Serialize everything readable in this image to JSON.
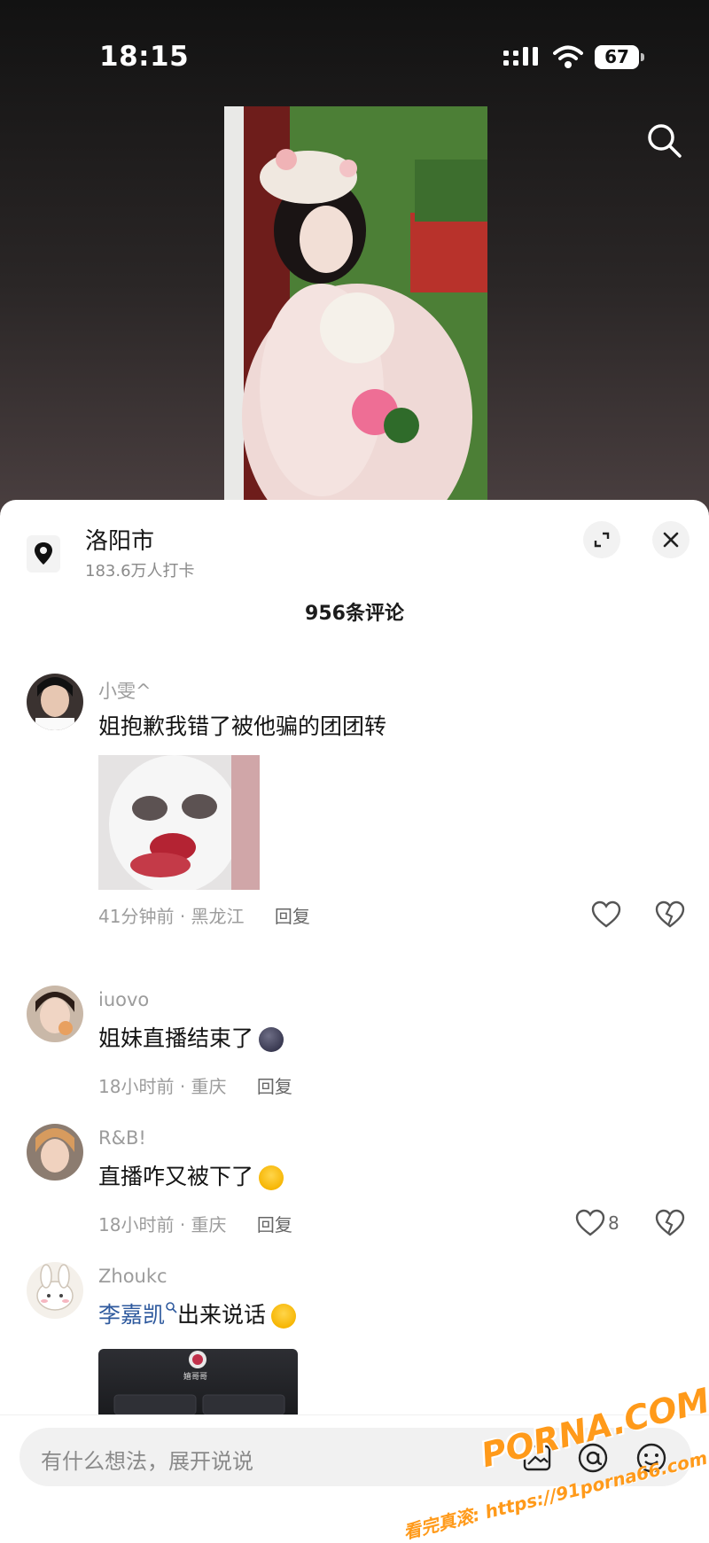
{
  "status_bar": {
    "time": "18:15",
    "battery": "67"
  },
  "location": {
    "name": "洛阳市",
    "checkins": "183.6万人打卡"
  },
  "comments_header": {
    "count_label": "956条评论"
  },
  "comments": [
    {
      "username": "小雯^",
      "text": "姐抱歉我错了被他骗的团团转",
      "time": "41分钟前",
      "location": "黑龙江",
      "reply_label": "回复",
      "has_image": true
    },
    {
      "username": "iuovo",
      "text": "姐妹直播结束了",
      "time": "18小时前",
      "location": "重庆",
      "reply_label": "回复"
    },
    {
      "username": "R&B!",
      "text": "直播咋又被下了",
      "time": "18小时前",
      "location": "重庆",
      "reply_label": "回复",
      "likes": "8"
    },
    {
      "username": "Zhoukc",
      "mention": "李嘉凯",
      "text": "出来说话",
      "video_name": "嬉哥哥"
    }
  ],
  "input": {
    "placeholder": "有什么想法，展开说说"
  },
  "watermark": {
    "brand": "PORNA.COM",
    "url": "看完真滚: https://91porna66.com"
  },
  "icons": {
    "search": "search-icon",
    "location": "location-pin-icon",
    "expand": "expand-icon",
    "close": "close-icon",
    "like": "heart-icon",
    "dislike": "broken-heart-icon",
    "image": "image-icon",
    "mention": "at-icon",
    "emoji": "emoji-icon"
  },
  "colors": {
    "mention": "#2f5a9e",
    "meta_gray": "#9c9c9c",
    "watermark": "#ff9a1a"
  }
}
